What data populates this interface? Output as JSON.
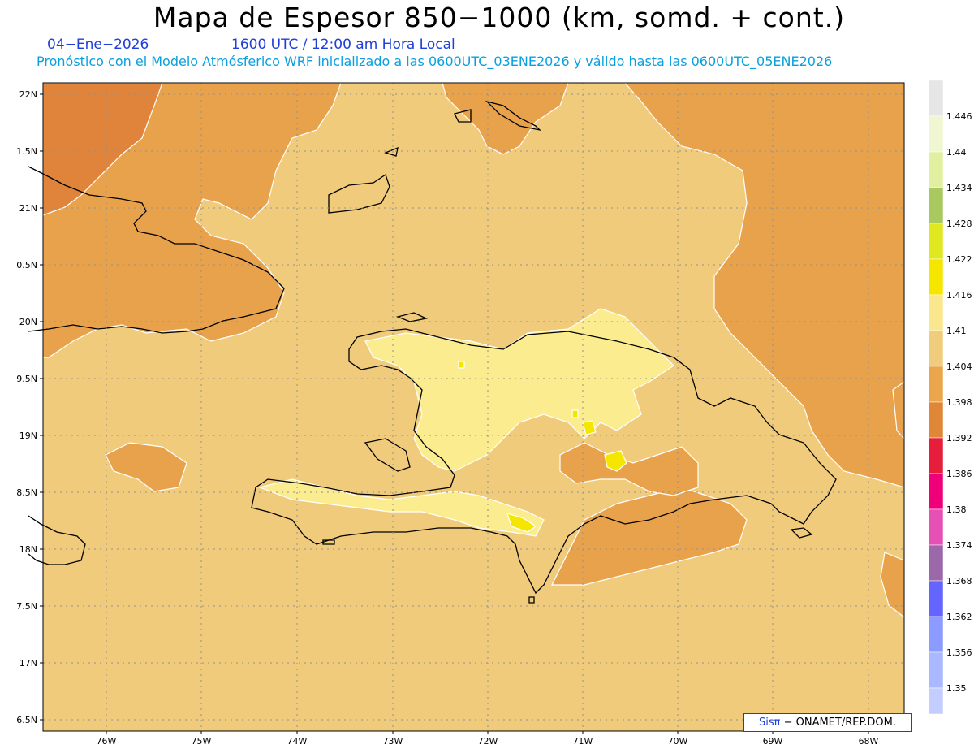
{
  "header": {
    "title": "Mapa de Espesor 850−1000 (km, somd. + cont.)",
    "date": "04−Ene−2026",
    "time": "1600 UTC / 12:00 am Hora Local",
    "model_info": "Pronóstico con el Modelo Atmósferico WRF inicializado a las 0600UTC_03ENE2026 y válido hasta las  0600UTC_05ENE2026"
  },
  "axes": {
    "lat_labels": [
      "22N",
      "1.5N",
      "21N",
      "0.5N",
      "20N",
      "9.5N",
      "19N",
      "8.5N",
      "18N",
      "7.5N",
      "17N",
      "6.5N"
    ],
    "lon_labels": [
      "76W",
      "75W",
      "74W",
      "73W",
      "72W",
      "71W",
      "70W",
      "69W",
      "68W"
    ]
  },
  "colorbar": {
    "labels": [
      "1.446",
      "1.44",
      "1.434",
      "1.428",
      "1.422",
      "1.416",
      "1.41",
      "1.404",
      "1.398",
      "1.392",
      "1.386",
      "1.38",
      "1.374",
      "1.368",
      "1.362",
      "1.356",
      "1.35"
    ],
    "colors": [
      "#e6e6e6",
      "#f0f5d2",
      "#e0f0a0",
      "#a8c860",
      "#e0e820",
      "#f5e600",
      "#fae68c",
      "#f0cd7d",
      "#eba54b",
      "#e08737",
      "#e61e3c",
      "#f00078",
      "#e650b4",
      "#9b69aa",
      "#6464ff",
      "#8c9bff",
      "#aab9ff",
      "#c3cdff"
    ]
  },
  "map_colors": {
    "c1392": "#df843a",
    "c1398": "#e9a24c",
    "c1404": "#f0cb7b",
    "c1410": "#faec8f",
    "c1416": "#f5e600"
  },
  "credit": {
    "sis": "Sis",
    "pi": "π",
    "rest": " − ONAMET/REP.DOM."
  }
}
